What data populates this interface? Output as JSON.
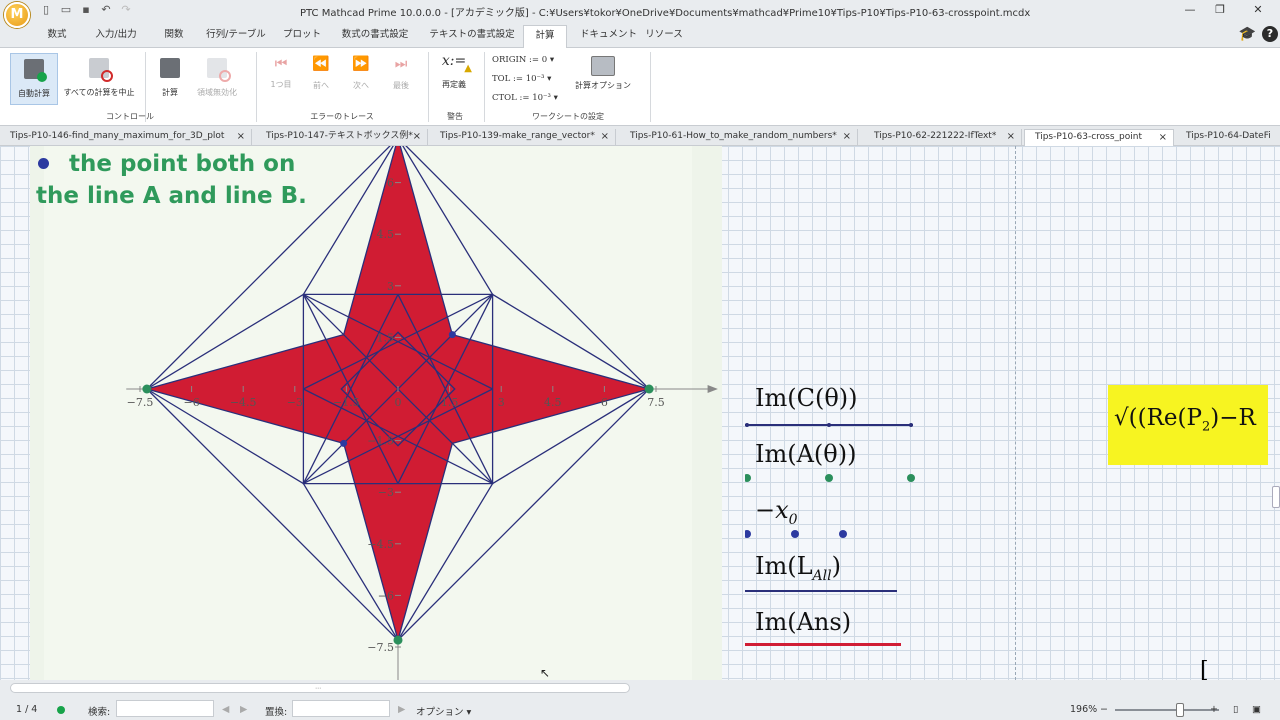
{
  "app": {
    "logo_letter": "M",
    "window_title": "PTC Mathcad Prime 10.0.0.0 - [アカデミック版] - C:¥Users¥tokor¥OneDrive¥Documents¥mathcad¥Prime10¥Tips-P10¥Tips-P10-63-crosspoint.mcdx",
    "win_minimize": "—",
    "win_restore": "❐",
    "win_close": "✕"
  },
  "menu": {
    "tabs": [
      "数式",
      "入力/出力",
      "関数",
      "行列/テーブル",
      "プロット",
      "数式の書式設定",
      "テキストの書式設定",
      "計算",
      "ドキュメント",
      "リソース"
    ],
    "active_tab": "計算",
    "help_label": "?"
  },
  "ribbon": {
    "auto_calc": "自動計算",
    "stop_all": "すべての計算を中止",
    "calculate": "計算",
    "disable_region": "領域無効化",
    "control_group": "コントロール",
    "first": "1つ目",
    "prev": "前へ",
    "next": "次へ",
    "last": "最後",
    "error_trace_group": "エラーのトレース",
    "redefine": "再定義",
    "warning_group": "警告",
    "origin_label": "ORIGIN :=",
    "origin_value": "0",
    "tol_label": "TOL :=",
    "tol_value": "10⁻³",
    "ctol_label": "CTOL :=",
    "ctol_value": "10⁻³",
    "calc_options": "計算オプション",
    "worksheet_settings_group": "ワークシートの設定"
  },
  "doc_tabs": [
    {
      "label": "Tips-P10-146-find_many_maximum_for_3D_plot",
      "close": "×"
    },
    {
      "label": "Tips-P10-147-テキストボックス例*",
      "close": "×"
    },
    {
      "label": "Tips-P10-139-make_range_vector*",
      "close": "×"
    },
    {
      "label": "Tips-P10-61-How_to_make_random_numbers*",
      "close": "×"
    },
    {
      "label": "Tips-P10-62-221222-IfText*",
      "close": "×"
    },
    {
      "label": "Tips-P10-63-cross_point",
      "close": "×"
    },
    {
      "label": "Tips-P10-64-DateFi",
      "close": ""
    }
  ],
  "active_doc_tab": "Tips-P10-63-cross_point",
  "annotation": {
    "line1": "the point both on",
    "line2": "the line A and line B."
  },
  "chart_data": {
    "type": "line",
    "xlim": [
      -7.5,
      7.5
    ],
    "ylim": [
      -7.5,
      7.5
    ],
    "x_tick_labels": [
      "−7.5",
      "−6",
      "−4.5",
      "−3",
      "−1.5",
      "0",
      "1.5",
      "3",
      "4.5",
      "6",
      "7.5"
    ],
    "y_tick_labels": [
      "7.5",
      "6",
      "4.5",
      "3",
      "1.5",
      "0",
      "−1.5",
      "−3",
      "−4.5",
      "−6",
      "−7.5"
    ],
    "star_fill_color": "#d01c33",
    "line_color": "#2a2f7a",
    "outer_points": [
      [
        0,
        7.3
      ],
      [
        7.3,
        0
      ],
      [
        0,
        -7.3
      ],
      [
        -7.3,
        0
      ]
    ],
    "inner_points": [
      [
        1.58,
        1.58
      ],
      [
        1.58,
        -1.58
      ],
      [
        -1.58,
        -1.58
      ],
      [
        -1.58,
        1.58
      ]
    ],
    "square_corners": [
      [
        2.75,
        2.75
      ],
      [
        2.75,
        -2.75
      ],
      [
        -2.75,
        -2.75
      ],
      [
        -2.75,
        2.75
      ]
    ],
    "series": [
      {
        "name": "Im(C(θ))",
        "color": "#2a2f7a",
        "style": "solid"
      },
      {
        "name": "Im(A(θ))",
        "color": "#2b8f5c",
        "style": "points"
      },
      {
        "name": "−x₀",
        "color": "#2c3aa0",
        "style": "points"
      },
      {
        "name": "Im(L_All)",
        "color": "#2a2f7a",
        "style": "solid"
      },
      {
        "name": "Im(Ans)",
        "color": "#d01c33",
        "style": "solid"
      }
    ]
  },
  "legend": {
    "c_theta": "Im(C(θ))",
    "a_theta": "Im(A(θ))",
    "x0": "−x",
    "x0_sub": "0",
    "l_all": "Im(L",
    "l_all_sub": "All",
    "ans": "Im(Ans)"
  },
  "yellow_expr": {
    "text": "√((Re(P",
    "sub": "2",
    "tail": ")−R"
  },
  "status": {
    "page": "1 / 4",
    "search_label": "検索:",
    "replace_label": "置換:",
    "options_label": "オプション",
    "zoom": "196%"
  },
  "colors": {
    "accent_green": "#2f9a5b",
    "star_red": "#d01c33",
    "navy": "#2a2f7a",
    "highlight_yellow": "#f7f421"
  }
}
